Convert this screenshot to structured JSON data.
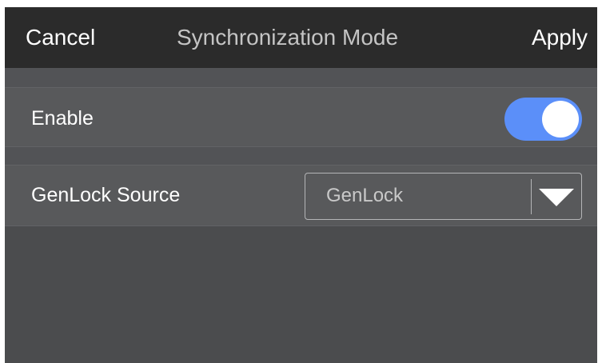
{
  "header": {
    "cancel_label": "Cancel",
    "title": "Synchronization Mode",
    "apply_label": "Apply"
  },
  "settings": {
    "enable": {
      "label": "Enable",
      "value": true
    },
    "genlock_source": {
      "label": "GenLock Source",
      "selected": "GenLock"
    }
  },
  "colors": {
    "header_bg": "#2b2b2b",
    "body_bg": "#4b4c4e",
    "row_bg": "#58595b",
    "toggle_on": "#5b8ff9",
    "title_text": "#c4c4c4"
  },
  "icons": {
    "dropdown": "chevron-down-icon"
  }
}
